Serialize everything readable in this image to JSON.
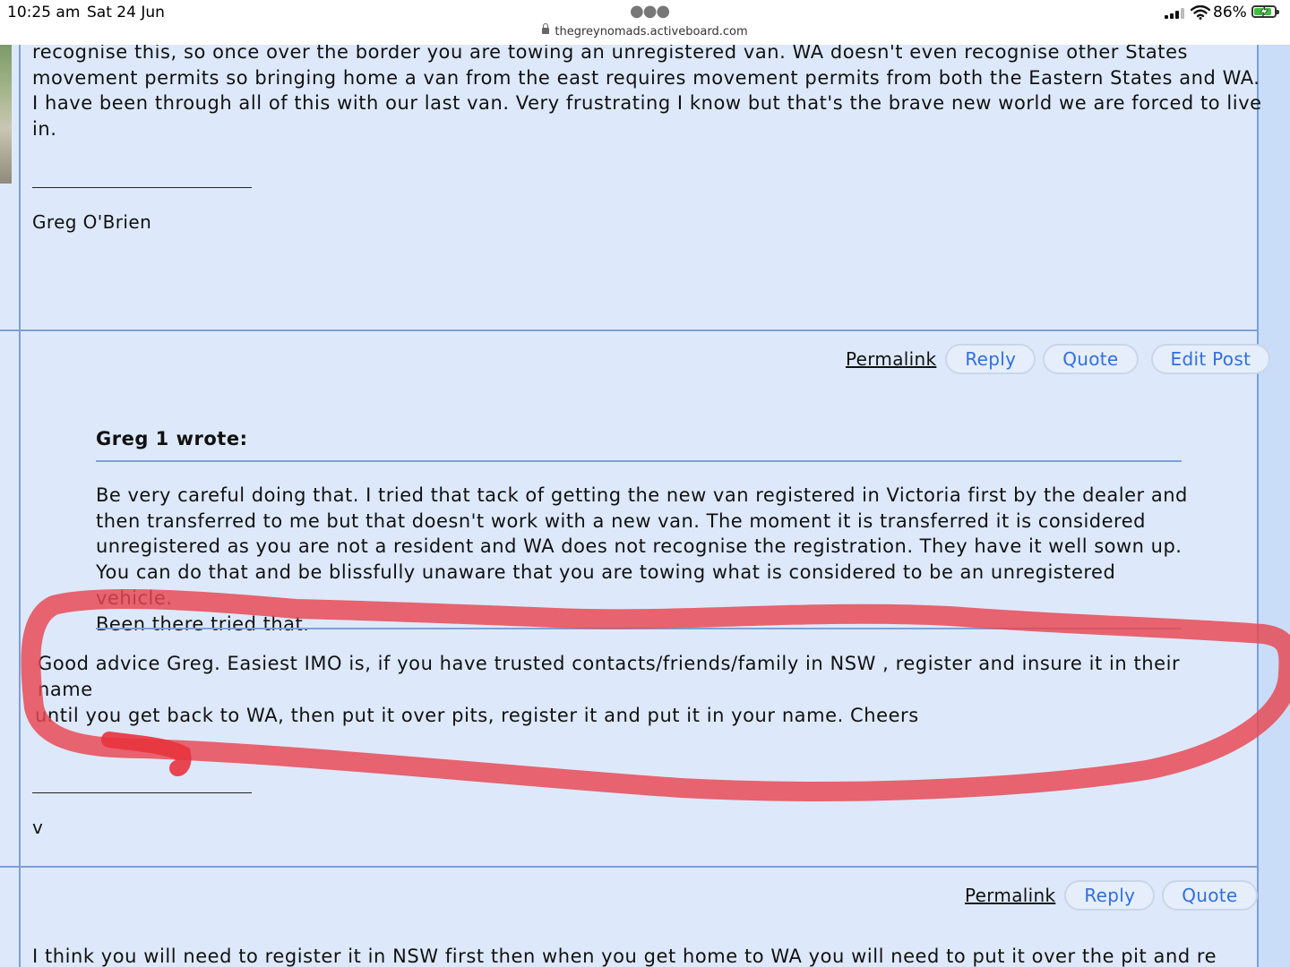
{
  "status_bar": {
    "time": "10:25 am",
    "date": "Sat 24 Jun",
    "url": "thegreynomads.activeboard.com",
    "battery": "86%",
    "battery_level": 0.86
  },
  "post1": {
    "text_lines": [
      "recognise this, so once over the border you are towing an unregistered van. WA doesn't even recognise other States",
      "movement permits so bringing home a van from the east requires movement permits from both the Eastern States and WA.",
      "I have been through all of this with our last van. Very frustrating I know but that's the brave new world we are forced to live",
      "in."
    ],
    "signature": "Greg O'Brien"
  },
  "post2": {
    "actions": {
      "permalink": "Permalink",
      "reply": "Reply",
      "quote": "Quote",
      "edit": "Edit Post"
    },
    "quote_author": "Greg 1 wrote:",
    "quote_lines": [
      "Be very careful doing that. I tried that tack of getting the new van registered in Victoria first by the dealer and",
      "then transferred to me but that doesn't work with a new van. The moment it is transferred it is considered",
      "unregistered as you are not a resident and WA does not recognise the registration. They have it well sown up.",
      "You can do that and be blissfully unaware that you are towing what is considered to be an unregistered vehicle.",
      "Been there tried that."
    ],
    "reply_lines": [
      "Good advice Greg. Easiest IMO is, if you have trusted contacts/friends/family in NSW , register and insure it in their name",
      "until you get back to WA, then put it over pits, register it and put it in your name. Cheers"
    ],
    "signature": "v"
  },
  "post3": {
    "actions": {
      "permalink": "Permalink",
      "reply": "Reply",
      "quote": "Quote"
    },
    "text_lines": [
      "I think you will need to register it in NSW first then when you get home to WA you will need to put it over the pit and re"
    ]
  },
  "colors": {
    "page_bg": "#dde9fb",
    "rule": "#7e9fd8",
    "button_text": "#2f6fdf",
    "annotation": "#e8454f"
  }
}
